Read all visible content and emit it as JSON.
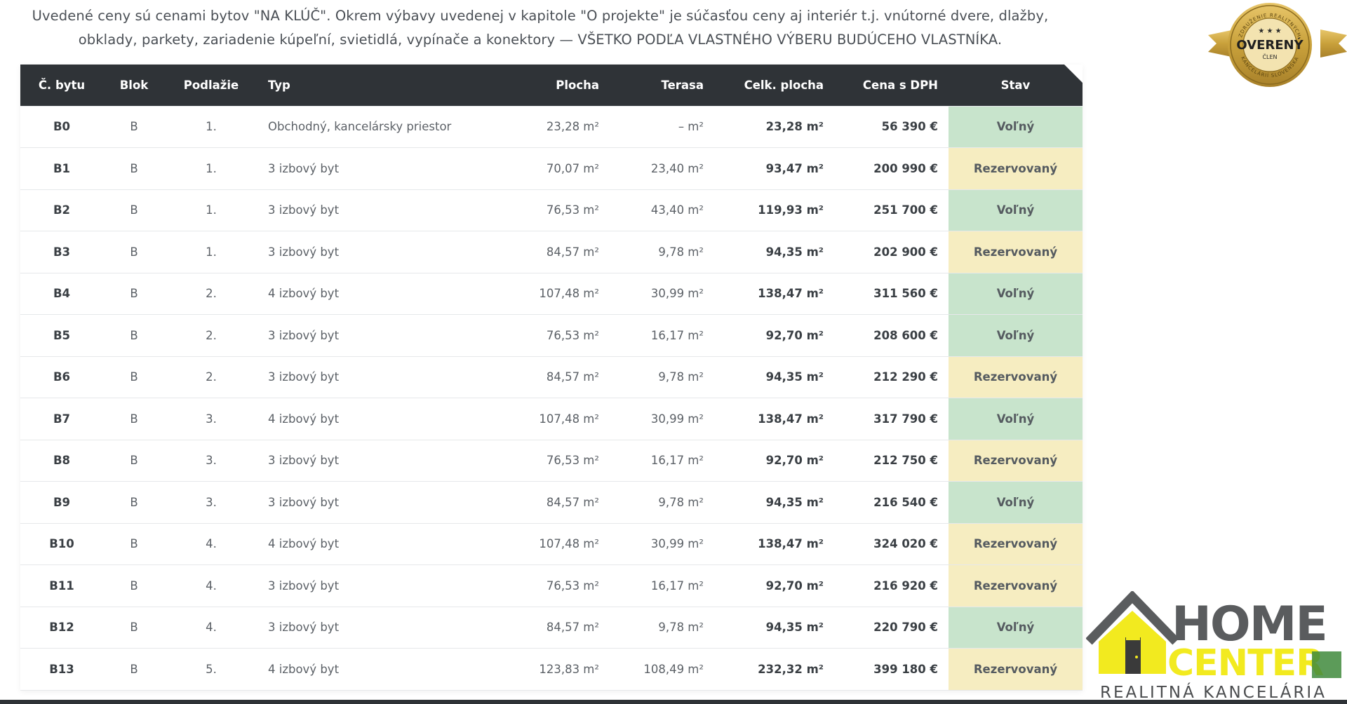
{
  "intro": {
    "line1": "Uvedené ceny sú cenami bytov \"NA KLÚČ\". Okrem výbavy uvedenej v kapitole \"O projekte\" je súčasťou ceny aj interiér t.j. vnútorné dvere, dlažby,",
    "line2": "obklady, parkety, zariadenie kúpeľní, svietidlá, vypínače a konektory — VŠETKO PODĽA VLASTNÉHO VÝBERU BUDÚCEHO VLASTNÍKA."
  },
  "table": {
    "headers": [
      "Č. bytu",
      "Blok",
      "Podlažie",
      "Typ",
      "Plocha",
      "Terasa",
      "Celk. plocha",
      "Cena s DPH",
      "Stav"
    ],
    "rows": [
      {
        "id": "B0",
        "blok": "B",
        "podlazie": "1.",
        "typ": "Obchodný, kancelársky priestor",
        "plocha": "23,28 m²",
        "terasa": "– m²",
        "celk": "23,28 m²",
        "cena": "56 390 €",
        "stav": "Voľný",
        "status": "free"
      },
      {
        "id": "B1",
        "blok": "B",
        "podlazie": "1.",
        "typ": "3 izbový byt",
        "plocha": "70,07 m²",
        "terasa": "23,40 m²",
        "celk": "93,47 m²",
        "cena": "200 990 €",
        "stav": "Rezervovaný",
        "status": "reserved"
      },
      {
        "id": "B2",
        "blok": "B",
        "podlazie": "1.",
        "typ": "3 izbový byt",
        "plocha": "76,53 m²",
        "terasa": "43,40 m²",
        "celk": "119,93 m²",
        "cena": "251 700 €",
        "stav": "Voľný",
        "status": "free"
      },
      {
        "id": "B3",
        "blok": "B",
        "podlazie": "1.",
        "typ": "3 izbový byt",
        "plocha": "84,57 m²",
        "terasa": "9,78 m²",
        "celk": "94,35 m²",
        "cena": "202 900 €",
        "stav": "Rezervovaný",
        "status": "reserved"
      },
      {
        "id": "B4",
        "blok": "B",
        "podlazie": "2.",
        "typ": "4 izbový byt",
        "plocha": "107,48 m²",
        "terasa": "30,99 m²",
        "celk": "138,47 m²",
        "cena": "311 560 €",
        "stav": "Voľný",
        "status": "free"
      },
      {
        "id": "B5",
        "blok": "B",
        "podlazie": "2.",
        "typ": "3 izbový byt",
        "plocha": "76,53 m²",
        "terasa": "16,17 m²",
        "celk": "92,70 m²",
        "cena": "208 600 €",
        "stav": "Voľný",
        "status": "free"
      },
      {
        "id": "B6",
        "blok": "B",
        "podlazie": "2.",
        "typ": "3 izbový byt",
        "plocha": "84,57 m²",
        "terasa": "9,78 m²",
        "celk": "94,35 m²",
        "cena": "212 290 €",
        "stav": "Rezervovaný",
        "status": "reserved"
      },
      {
        "id": "B7",
        "blok": "B",
        "podlazie": "3.",
        "typ": "4 izbový byt",
        "plocha": "107,48 m²",
        "terasa": "30,99 m²",
        "celk": "138,47 m²",
        "cena": "317 790 €",
        "stav": "Voľný",
        "status": "free"
      },
      {
        "id": "B8",
        "blok": "B",
        "podlazie": "3.",
        "typ": "3 izbový byt",
        "plocha": "76,53 m²",
        "terasa": "16,17 m²",
        "celk": "92,70 m²",
        "cena": "212 750 €",
        "stav": "Rezervovaný",
        "status": "reserved"
      },
      {
        "id": "B9",
        "blok": "B",
        "podlazie": "3.",
        "typ": "3 izbový byt",
        "plocha": "84,57 m²",
        "terasa": "9,78 m²",
        "celk": "94,35 m²",
        "cena": "216 540 €",
        "stav": "Voľný",
        "status": "free"
      },
      {
        "id": "B10",
        "blok": "B",
        "podlazie": "4.",
        "typ": "4 izbový byt",
        "plocha": "107,48 m²",
        "terasa": "30,99 m²",
        "celk": "138,47 m²",
        "cena": "324 020 €",
        "stav": "Rezervovaný",
        "status": "reserved"
      },
      {
        "id": "B11",
        "blok": "B",
        "podlazie": "4.",
        "typ": "3 izbový byt",
        "plocha": "76,53 m²",
        "terasa": "16,17 m²",
        "celk": "92,70 m²",
        "cena": "216 920 €",
        "stav": "Rezervovaný",
        "status": "reserved"
      },
      {
        "id": "B12",
        "blok": "B",
        "podlazie": "4.",
        "typ": "3 izbový byt",
        "plocha": "84,57 m²",
        "terasa": "9,78 m²",
        "celk": "94,35 m²",
        "cena": "220 790 €",
        "stav": "Voľný",
        "status": "free"
      },
      {
        "id": "B13",
        "blok": "B",
        "podlazie": "5.",
        "typ": "4 izbový byt",
        "plocha": "123,83 m²",
        "terasa": "108,49 m²",
        "celk": "232,32 m²",
        "cena": "399 180 €",
        "stav": "Rezervovaný",
        "status": "reserved"
      }
    ]
  },
  "badge": {
    "main": "OVERENÝ",
    "sub": "ČLEN",
    "ring_top": "ZDRUŽENIE REALITNÝCH",
    "ring_bottom": "KANCELÁRIÍ SLOVENSKA"
  },
  "logo": {
    "word1": "HOME",
    "word2": "CENTER",
    "tagline": "REALITNÁ KANCELÁRIA"
  },
  "colors": {
    "header_bg": "#2f3337",
    "free_bg": "#c8e4cc",
    "reserved_bg": "#f6edc1",
    "logo_yellow": "#f2ea1f",
    "logo_green": "#3f8a3c",
    "logo_gray": "#5a5c5e",
    "badge_gold": "#c9a13b"
  }
}
